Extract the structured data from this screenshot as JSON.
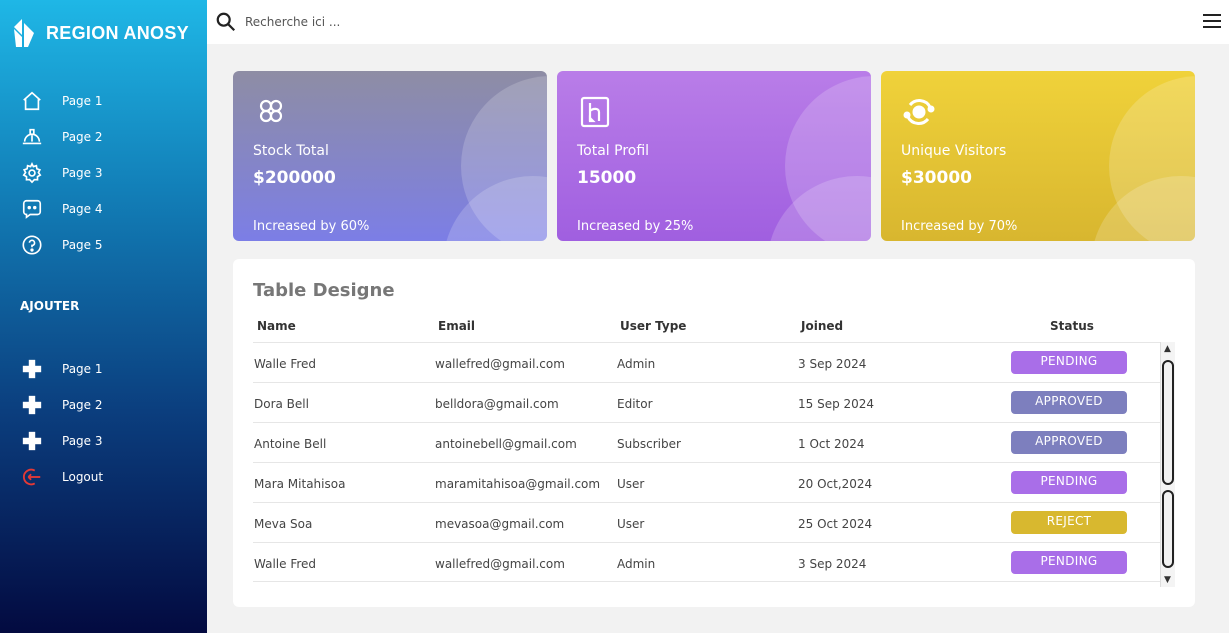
{
  "sidebar": {
    "brand": "REGION ANOSY",
    "nav": [
      {
        "label": "Page 1",
        "icon": "home-icon"
      },
      {
        "label": "Page 2",
        "icon": "helmet-icon"
      },
      {
        "label": "Page 3",
        "icon": "gear-icon"
      },
      {
        "label": "Page 4",
        "icon": "chat-icon"
      },
      {
        "label": "Page 5",
        "icon": "help-icon"
      }
    ],
    "section_label": "AJOUTER",
    "add_items": [
      {
        "label": "Page 1",
        "icon": "plus-icon"
      },
      {
        "label": "Page 2",
        "icon": "plus-icon"
      },
      {
        "label": "Page 3",
        "icon": "plus-icon"
      }
    ],
    "logout": {
      "label": "Logout",
      "icon": "logout-icon",
      "color": "#e53935"
    }
  },
  "topbar": {
    "search_placeholder": "Recherche ici ...",
    "search_icon": "search-icon",
    "menu_icon": "hamburger-icon"
  },
  "cards": [
    {
      "title": "Stock Total",
      "value": "$200000",
      "subtitle": "Increased by 60%",
      "icon": "hexagons-icon"
    },
    {
      "title": "Total Profil",
      "value": "15000",
      "subtitle": "Increased by 25%",
      "icon": "heroku-icon"
    },
    {
      "title": "Unique Visitors",
      "value": "$30000",
      "subtitle": "Increased by 70%",
      "icon": "orbit-icon"
    }
  ],
  "table": {
    "title": "Table Designe",
    "columns": [
      "Name",
      "Email",
      "User Type",
      "Joined",
      "Status"
    ],
    "rows": [
      {
        "name": "Walle Fred",
        "email": "wallefred@gmail.com",
        "type": "Admin",
        "joined": "3 Sep 2024",
        "status": "PENDING"
      },
      {
        "name": "Dora Bell",
        "email": "belldora@gmail.com",
        "type": "Editor",
        "joined": "15 Sep 2024",
        "status": "APPROVED"
      },
      {
        "name": "Antoine Bell",
        "email": "antoinebell@gmail.com",
        "type": "Subscriber",
        "joined": "1 Oct 2024",
        "status": "APPROVED"
      },
      {
        "name": "Mara Mitahisoa",
        "email": "maramitahisoa@gmail.com",
        "type": "User",
        "joined": "20 Oct,2024",
        "status": "PENDING"
      },
      {
        "name": "Meva Soa",
        "email": "mevasoa@gmail.com",
        "type": "User",
        "joined": "25 Oct 2024",
        "status": "REJECT"
      },
      {
        "name": "Walle Fred",
        "email": "wallefred@gmail.com",
        "type": "Admin",
        "joined": "3 Sep 2024",
        "status": "PENDING"
      }
    ]
  },
  "colors": {
    "pending": "#a96ee8",
    "approved": "#7d7fbe",
    "reject": "#d8b82f"
  }
}
